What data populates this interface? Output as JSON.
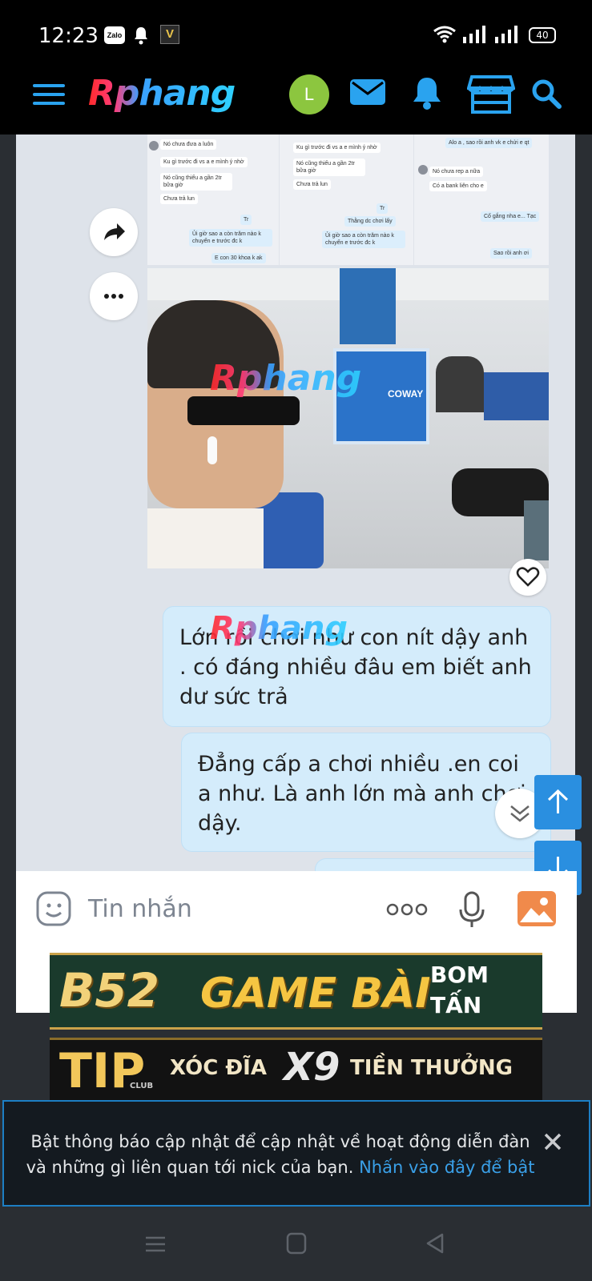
{
  "status_bar": {
    "time": "12:23",
    "zalo_label": "Zalo",
    "v_label": "V",
    "battery": "40"
  },
  "header": {
    "logo_text": "Rphang",
    "avatar_letter": "L"
  },
  "chat_screenshot": {
    "col1": [
      "Nó chưa đưa a luôn",
      "Ku gì trước đi vs a e mình ý nhờ",
      "Nó cũng thiếu a gần 2tr bữa giờ",
      "Chưa trả lun",
      "Tr",
      "Ủi giờ sao a còn trăm nào k chuyển e trước đc k",
      "E con 30 khoa k ak"
    ],
    "col2": [
      "Ku gì trước đi vs a e mình ý nhờ",
      "Nó cũng thiếu a gần 2tr bữa giờ",
      "Chưa trả lun",
      "Tr",
      "Thằng dc chơi lấy",
      "Ủi giờ sao a còn trăm nào k chuyển e trước đc k"
    ],
    "col3": [
      "Alo a , sao rồi anh vk e chửi e qt",
      "Nó chưa rep a nữa",
      "Có a bank liên cho e",
      "Cố gắng nha e... Tạc",
      "Sao rồi anh ơi"
    ]
  },
  "photo": {
    "watermark": "Rphang",
    "kiosk_label": "COWAY"
  },
  "messages": [
    "Lớn rồi chơi như con nít dậy anh . có đáng nhiều đâu em biết anh dư sức trả",
    "Đẳng cấp a chơi nhiều .en  coi a như. Là anh lớn mà anh chơi dậy."
  ],
  "bubble_watermark": "Rphang",
  "composer": {
    "placeholder": "Tin nhắn"
  },
  "ads": {
    "b52_logo": "B52",
    "b52_title": "GAME BÀI",
    "b52_side_1": "BOM",
    "b52_side_2": "TẤN",
    "tip_logo": "TIP",
    "tip_club": "CLUB",
    "tip_text_1": "XÓC ĐĨA",
    "tip_x9": "X9",
    "tip_text_2": "TIỀN THƯỞNG"
  },
  "notice": {
    "text": "Bật thông báo cập nhật để cập nhật về hoạt động diễn đàn và những gì liên quan tới nick của bạn.",
    "link": "Nhấn vào đây để bật"
  },
  "colors": {
    "accent_blue": "#2a8fe0",
    "bubble": "#d4ecfb",
    "avatar_green": "#8cc63f"
  }
}
